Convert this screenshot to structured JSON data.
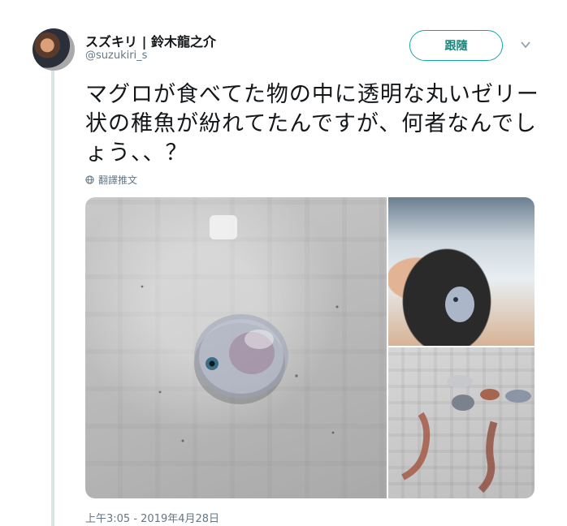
{
  "tweet": {
    "display_name": "スズキリ | 鈴木龍之介",
    "handle": "@suzukiri_s",
    "follow_label": "跟隨",
    "text": "マグロが食べてた物の中に透明な丸いゼリー状の稚魚が紛れてたんですが、何者なんでしょう、、？",
    "translate_label": "翻譯推文",
    "timestamp": "上午3:05 - 2019年4月28日"
  },
  "media": {
    "photo_count": 3
  },
  "colors": {
    "accent": "#17a7a0",
    "thread_line": "#d8e6e4",
    "secondary_text": "#657786"
  },
  "icons": {
    "translate": "globe-icon",
    "menu": "chevron-down-icon"
  }
}
